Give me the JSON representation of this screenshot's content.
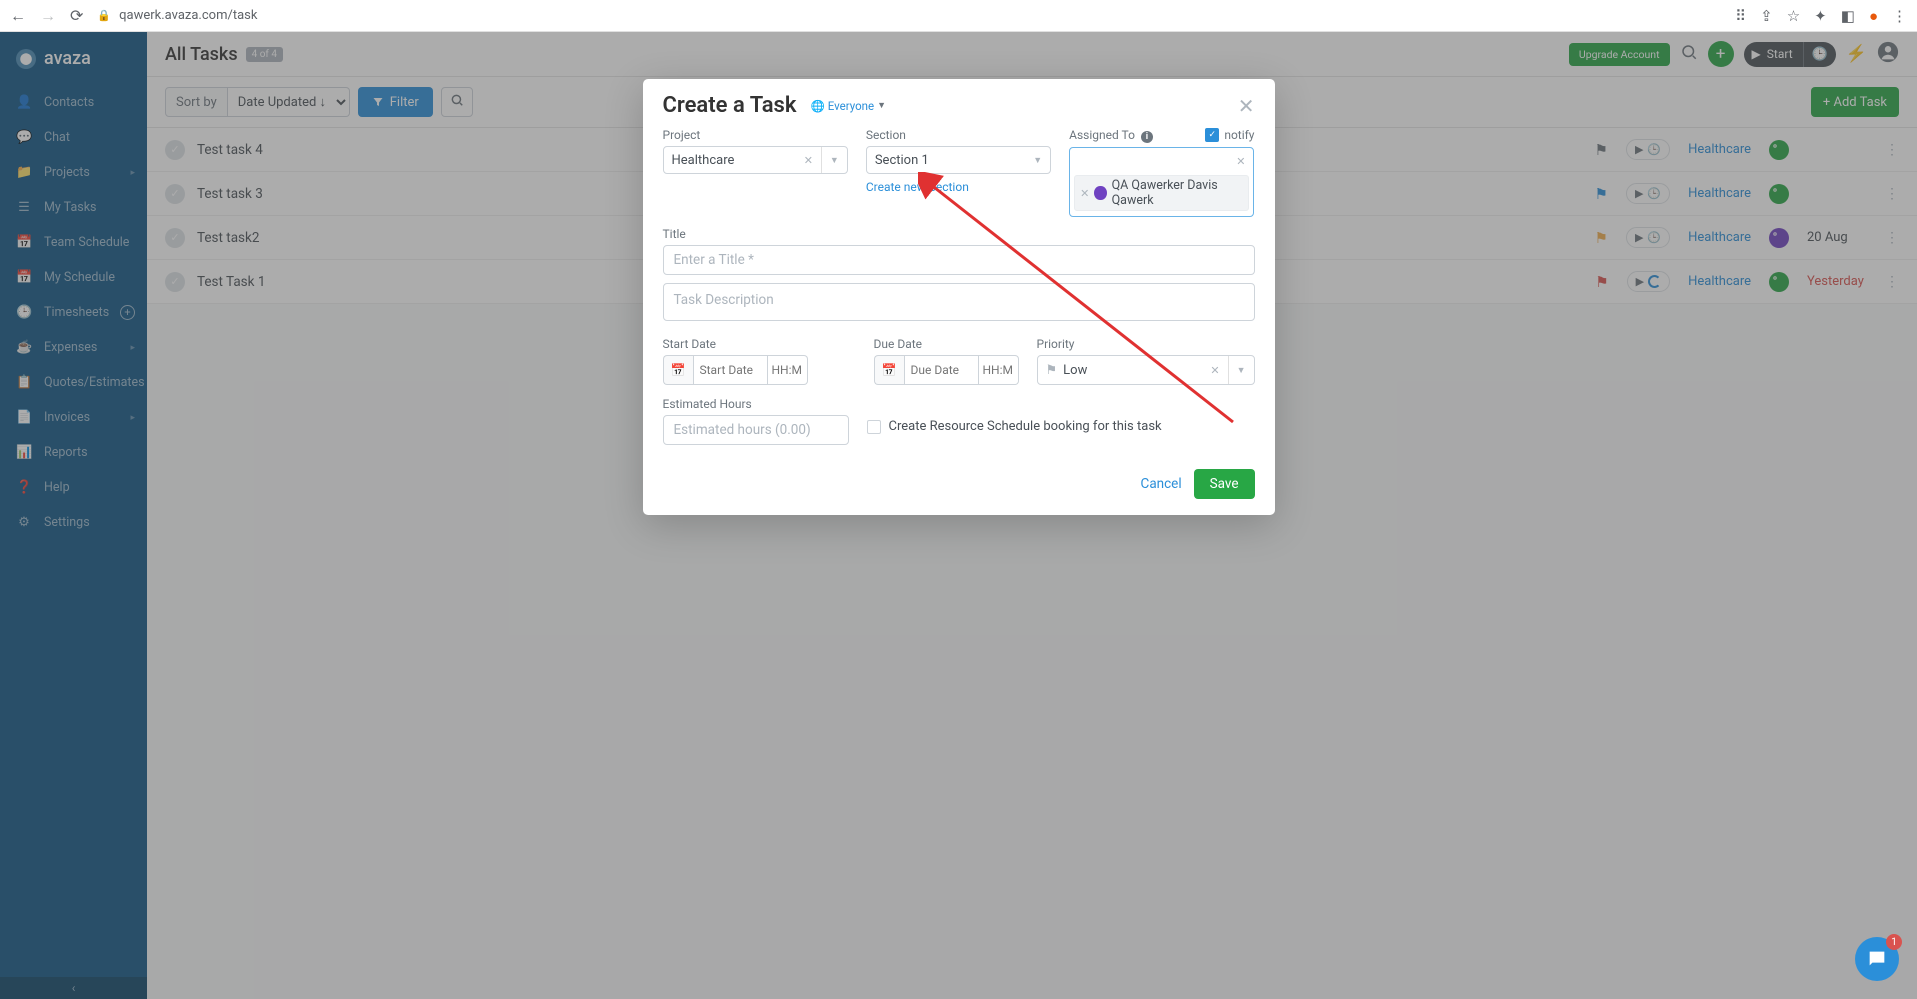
{
  "browser": {
    "url": "qawerk.avaza.com/task"
  },
  "brand": "avaza",
  "sidebar": [
    {
      "icon": "👤",
      "label": "Contacts"
    },
    {
      "icon": "💬",
      "label": "Chat"
    },
    {
      "icon": "📁",
      "label": "Projects",
      "expand": true
    },
    {
      "icon": "☰",
      "label": "My Tasks"
    },
    {
      "icon": "📅",
      "label": "Team Schedule"
    },
    {
      "icon": "📅",
      "label": "My Schedule"
    },
    {
      "icon": "🕒",
      "label": "Timesheets",
      "plus": true
    },
    {
      "icon": "☕",
      "label": "Expenses",
      "expand": true
    },
    {
      "icon": "📋",
      "label": "Quotes/Estimates"
    },
    {
      "icon": "📄",
      "label": "Invoices",
      "expand": true
    },
    {
      "icon": "📊",
      "label": "Reports"
    },
    {
      "icon": "❓",
      "label": "Help"
    },
    {
      "icon": "⚙",
      "label": "Settings"
    }
  ],
  "header": {
    "title": "All Tasks",
    "count": "4 of 4",
    "upgrade": "Upgrade Account",
    "start": "Start",
    "add_task": "+ Add Task"
  },
  "toolbar": {
    "sort_label": "Sort by",
    "sort_value": "Date Updated ↓",
    "filter": "Filter"
  },
  "tasks": [
    {
      "name": "Test task 4",
      "flag": "#6c757d",
      "project": "Healthcare",
      "avatar": "#28a745",
      "date": "",
      "timer_alt": false
    },
    {
      "name": "Test task 3",
      "flag": "#2b8fd9",
      "project": "Healthcare",
      "avatar": "#28a745",
      "date": "",
      "timer_alt": false
    },
    {
      "name": "Test task2",
      "flag": "#f0ad4e",
      "project": "Healthcare",
      "avatar": "#6f42c1",
      "date": "20 Aug",
      "timer_alt": false
    },
    {
      "name": "Test Task 1",
      "flag": "#d9534f",
      "project": "Healthcare",
      "avatar": "#28a745",
      "date": "Yesterday",
      "date_red": true,
      "timer_alt": true
    }
  ],
  "modal": {
    "title": "Create a Task",
    "visibility_icon": "🌐",
    "visibility": "Everyone",
    "labels": {
      "project": "Project",
      "section": "Section",
      "assigned": "Assigned To",
      "notify": "notify",
      "title": "Title",
      "start": "Start Date",
      "due": "Due Date",
      "priority": "Priority",
      "hours": "Estimated Hours",
      "create_booking": "Create Resource Schedule booking for this task",
      "create_section": "Create new Section"
    },
    "project_value": "Healthcare",
    "section_value": "Section 1",
    "assigned_chip": "QA Qawerker Davis Qawerk",
    "priority_value": "Low",
    "placeholders": {
      "title": "Enter a Title *",
      "desc": "Task Description",
      "start": "Start Date",
      "due": "Due Date",
      "time": "HH:MM",
      "hours": "Estimated hours (0.00)"
    },
    "cancel": "Cancel",
    "save": "Save"
  },
  "chat_badge": "1"
}
